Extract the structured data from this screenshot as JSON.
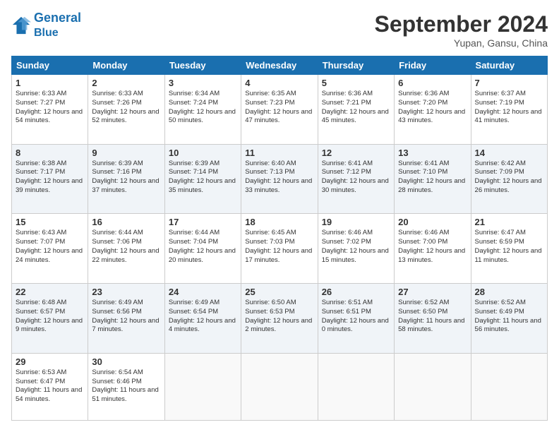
{
  "header": {
    "logo_line1": "General",
    "logo_line2": "Blue",
    "month": "September 2024",
    "location": "Yupan, Gansu, China"
  },
  "weekdays": [
    "Sunday",
    "Monday",
    "Tuesday",
    "Wednesday",
    "Thursday",
    "Friday",
    "Saturday"
  ],
  "weeks": [
    [
      {
        "day": "1",
        "sunrise": "6:33 AM",
        "sunset": "7:27 PM",
        "daylight": "12 hours and 54 minutes."
      },
      {
        "day": "2",
        "sunrise": "6:33 AM",
        "sunset": "7:26 PM",
        "daylight": "12 hours and 52 minutes."
      },
      {
        "day": "3",
        "sunrise": "6:34 AM",
        "sunset": "7:24 PM",
        "daylight": "12 hours and 50 minutes."
      },
      {
        "day": "4",
        "sunrise": "6:35 AM",
        "sunset": "7:23 PM",
        "daylight": "12 hours and 47 minutes."
      },
      {
        "day": "5",
        "sunrise": "6:36 AM",
        "sunset": "7:21 PM",
        "daylight": "12 hours and 45 minutes."
      },
      {
        "day": "6",
        "sunrise": "6:36 AM",
        "sunset": "7:20 PM",
        "daylight": "12 hours and 43 minutes."
      },
      {
        "day": "7",
        "sunrise": "6:37 AM",
        "sunset": "7:19 PM",
        "daylight": "12 hours and 41 minutes."
      }
    ],
    [
      {
        "day": "8",
        "sunrise": "6:38 AM",
        "sunset": "7:17 PM",
        "daylight": "12 hours and 39 minutes."
      },
      {
        "day": "9",
        "sunrise": "6:39 AM",
        "sunset": "7:16 PM",
        "daylight": "12 hours and 37 minutes."
      },
      {
        "day": "10",
        "sunrise": "6:39 AM",
        "sunset": "7:14 PM",
        "daylight": "12 hours and 35 minutes."
      },
      {
        "day": "11",
        "sunrise": "6:40 AM",
        "sunset": "7:13 PM",
        "daylight": "12 hours and 33 minutes."
      },
      {
        "day": "12",
        "sunrise": "6:41 AM",
        "sunset": "7:12 PM",
        "daylight": "12 hours and 30 minutes."
      },
      {
        "day": "13",
        "sunrise": "6:41 AM",
        "sunset": "7:10 PM",
        "daylight": "12 hours and 28 minutes."
      },
      {
        "day": "14",
        "sunrise": "6:42 AM",
        "sunset": "7:09 PM",
        "daylight": "12 hours and 26 minutes."
      }
    ],
    [
      {
        "day": "15",
        "sunrise": "6:43 AM",
        "sunset": "7:07 PM",
        "daylight": "12 hours and 24 minutes."
      },
      {
        "day": "16",
        "sunrise": "6:44 AM",
        "sunset": "7:06 PM",
        "daylight": "12 hours and 22 minutes."
      },
      {
        "day": "17",
        "sunrise": "6:44 AM",
        "sunset": "7:04 PM",
        "daylight": "12 hours and 20 minutes."
      },
      {
        "day": "18",
        "sunrise": "6:45 AM",
        "sunset": "7:03 PM",
        "daylight": "12 hours and 17 minutes."
      },
      {
        "day": "19",
        "sunrise": "6:46 AM",
        "sunset": "7:02 PM",
        "daylight": "12 hours and 15 minutes."
      },
      {
        "day": "20",
        "sunrise": "6:46 AM",
        "sunset": "7:00 PM",
        "daylight": "12 hours and 13 minutes."
      },
      {
        "day": "21",
        "sunrise": "6:47 AM",
        "sunset": "6:59 PM",
        "daylight": "12 hours and 11 minutes."
      }
    ],
    [
      {
        "day": "22",
        "sunrise": "6:48 AM",
        "sunset": "6:57 PM",
        "daylight": "12 hours and 9 minutes."
      },
      {
        "day": "23",
        "sunrise": "6:49 AM",
        "sunset": "6:56 PM",
        "daylight": "12 hours and 7 minutes."
      },
      {
        "day": "24",
        "sunrise": "6:49 AM",
        "sunset": "6:54 PM",
        "daylight": "12 hours and 4 minutes."
      },
      {
        "day": "25",
        "sunrise": "6:50 AM",
        "sunset": "6:53 PM",
        "daylight": "12 hours and 2 minutes."
      },
      {
        "day": "26",
        "sunrise": "6:51 AM",
        "sunset": "6:51 PM",
        "daylight": "12 hours and 0 minutes."
      },
      {
        "day": "27",
        "sunrise": "6:52 AM",
        "sunset": "6:50 PM",
        "daylight": "11 hours and 58 minutes."
      },
      {
        "day": "28",
        "sunrise": "6:52 AM",
        "sunset": "6:49 PM",
        "daylight": "11 hours and 56 minutes."
      }
    ],
    [
      {
        "day": "29",
        "sunrise": "6:53 AM",
        "sunset": "6:47 PM",
        "daylight": "11 hours and 54 minutes."
      },
      {
        "day": "30",
        "sunrise": "6:54 AM",
        "sunset": "6:46 PM",
        "daylight": "11 hours and 51 minutes."
      },
      null,
      null,
      null,
      null,
      null
    ]
  ]
}
